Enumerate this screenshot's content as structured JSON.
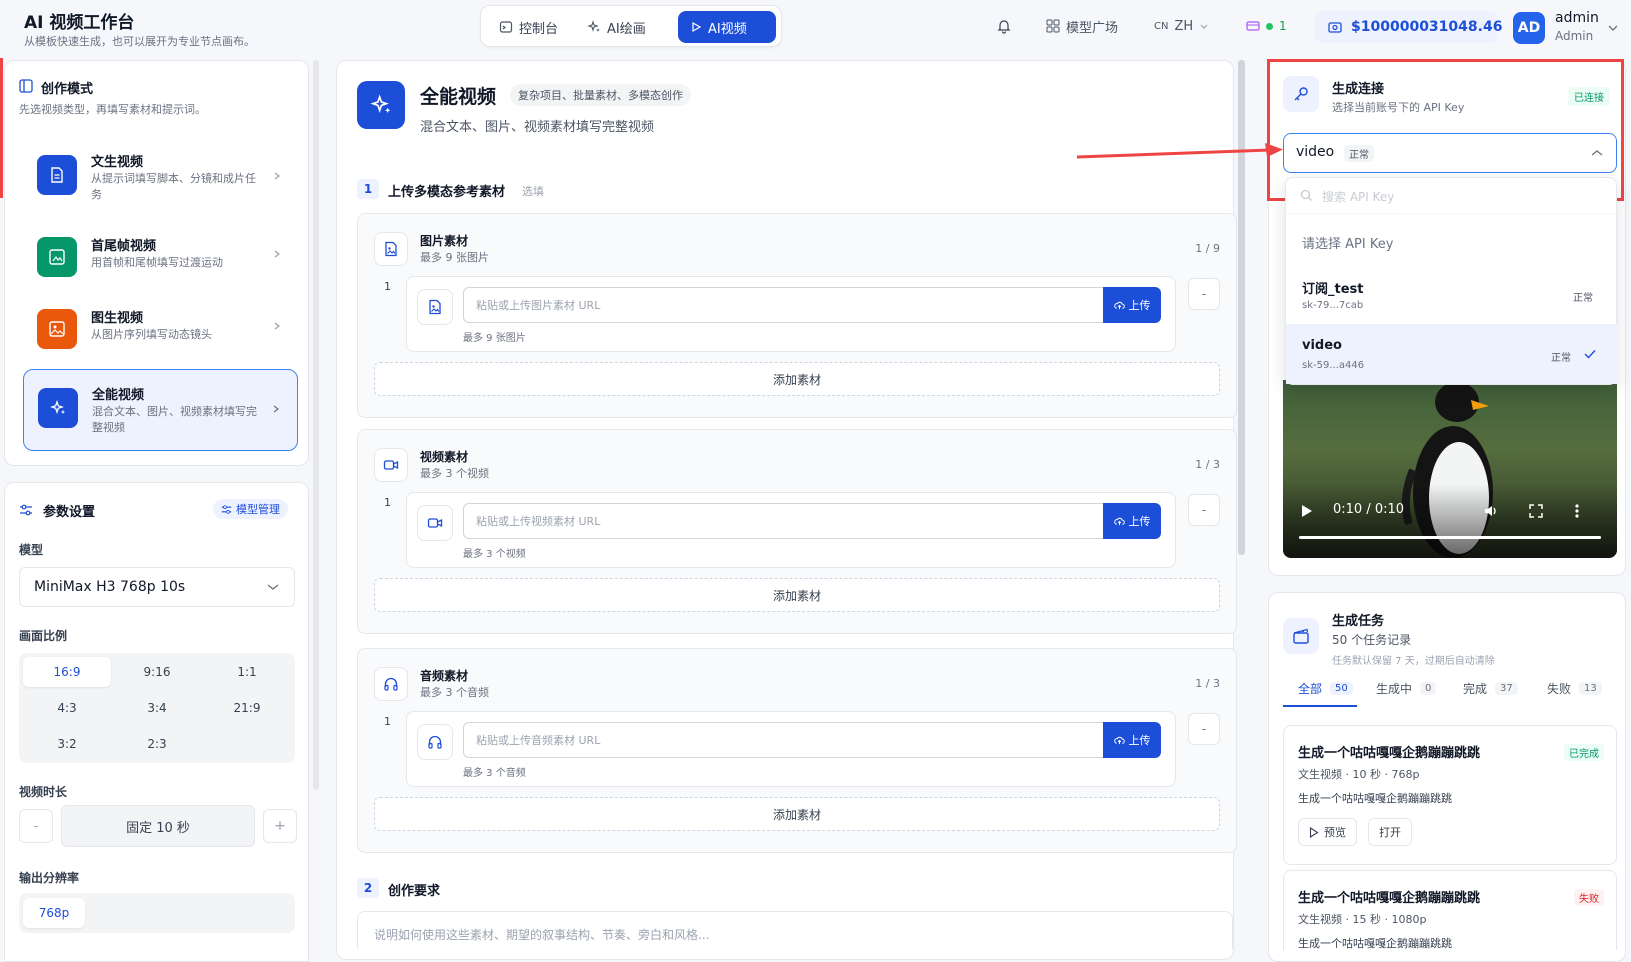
{
  "header": {
    "title": "AI 视频工作台",
    "subtitle": "从模板快速生成，也可以展开为专业节点画布。",
    "nav": [
      {
        "label": "控制台",
        "icon": "console-icon"
      },
      {
        "label": "AI绘画",
        "icon": "sparkle-icon"
      },
      {
        "label": "AI视频",
        "icon": "play-icon"
      }
    ],
    "model_market": "模型广场",
    "lang_flag": "CN",
    "lang": "ZH",
    "status_count": "1",
    "balance": "$100000031048.46",
    "avatar": "AD",
    "username": "admin",
    "role": "Admin"
  },
  "left": {
    "mode_title": "创作模式",
    "mode_desc": "先选视频类型，再填写素材和提示词。",
    "modes": [
      {
        "title": "文生视频",
        "desc": "从提示词填写脚本、分镜和成片任务",
        "color": "#1d4ed8"
      },
      {
        "title": "首尾帧视频",
        "desc": "用首帧和尾帧填写过渡运动",
        "color": "#059669"
      },
      {
        "title": "图生视频",
        "desc": "从图片序列填写动态镜头",
        "color": "#ea580c"
      },
      {
        "title": "全能视频",
        "desc": "混合文本、图片、视频素材填写完整视频",
        "color": "#1d4ed8"
      }
    ],
    "params_title": "参数设置",
    "model_mgmt": "模型管理",
    "model_label": "模型",
    "model_value": "MiniMax H3 768p 10s",
    "ratio_label": "画面比例",
    "ratios": [
      "16:9",
      "9:16",
      "1:1",
      "4:3",
      "3:4",
      "21:9",
      "3:2",
      "2:3"
    ],
    "ratio_selected": "16:9",
    "duration_label": "视频时长",
    "duration_minus": "-",
    "duration_value": "固定 10 秒",
    "duration_plus": "+",
    "resolution_label": "输出分辨率",
    "resolution_value": "768p"
  },
  "main": {
    "title": "全能视频",
    "tag": "复杂项目、批量素材、多模态创作",
    "subtitle": "混合文本、图片、视频素材填写完整视频",
    "step1": {
      "num": "1",
      "title": "上传多模态参考素材",
      "opt": "选填"
    },
    "materials": [
      {
        "title": "图片素材",
        "sub": "最多 9 张图片",
        "count": "1 / 9",
        "idx": "1",
        "placeholder": "粘贴或上传图片素材 URL",
        "upload": "上传",
        "hint": "最多 9 张图片",
        "remove": "-",
        "add": "添加素材"
      },
      {
        "title": "视频素材",
        "sub": "最多 3 个视频",
        "count": "1 / 3",
        "idx": "1",
        "placeholder": "粘贴或上传视频素材 URL",
        "upload": "上传",
        "hint": "最多 3 个视频",
        "remove": "-",
        "add": "添加素材"
      },
      {
        "title": "音频素材",
        "sub": "最多 3 个音频",
        "count": "1 / 3",
        "idx": "1",
        "placeholder": "粘贴或上传音频素材 URL",
        "upload": "上传",
        "hint": "最多 3 个音频",
        "remove": "-",
        "add": "添加素材"
      }
    ],
    "step2": {
      "num": "2",
      "title": "创作要求"
    },
    "prompt_placeholder": "说明如何使用这些素材、期望的叙事结构、节奏、旁白和风格..."
  },
  "right": {
    "conn_title": "生成连接",
    "conn_desc": "选择当前账号下的 API Key",
    "conn_status": "已连接",
    "select_value": "video",
    "select_status": "正常",
    "search_placeholder": "搜索 API Key",
    "dd_header": "请选择 API Key",
    "keys": [
      {
        "name": "订阅_test",
        "key": "sk-79...7cab",
        "status": "正常",
        "selected": false
      },
      {
        "name": "video",
        "key": "sk-59...a446",
        "status": "正常",
        "selected": true
      }
    ],
    "video_time": "0:10 / 0:10",
    "video_progress": 1.0,
    "tasks_title": "生成任务",
    "tasks_count": "50 个任务记录",
    "tasks_note": "任务默认保留 7 天，过期后自动清除",
    "tabs": [
      {
        "label": "全部",
        "count": "50"
      },
      {
        "label": "生成中",
        "count": "0"
      },
      {
        "label": "完成",
        "count": "37"
      },
      {
        "label": "失败",
        "count": "13"
      }
    ],
    "task_list": [
      {
        "title": "生成一个咕咕嘎嘎企鹅蹦蹦跳跳",
        "status": "已完成",
        "status_color": "#059669",
        "meta": "文生视频 · 10 秒 · 768p",
        "prompt": "生成一个咕咕嘎嘎企鹅蹦蹦跳跳",
        "preview": "预览",
        "open": "打开"
      },
      {
        "title": "生成一个咕咕嘎嘎企鹅蹦蹦跳跳",
        "status": "失败",
        "status_color": "#dc2626",
        "meta": "文生视频 · 15 秒 · 1080p",
        "prompt": "生成一个咕咕嘎嘎企鹅蹦蹦跳跳"
      }
    ]
  },
  "colors": {
    "primary": "#1d4ed8",
    "annotation": "#ef4444",
    "success": "#059669",
    "danger": "#dc2626"
  }
}
